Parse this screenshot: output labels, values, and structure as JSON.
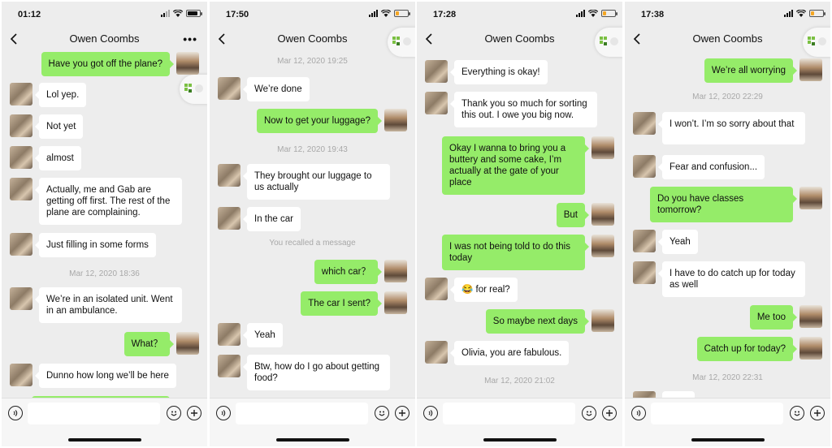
{
  "colors": {
    "outgoing": "#95ec69",
    "incoming": "#ffffff",
    "background": "#ededed",
    "timestamp": "#a8a8a8"
  },
  "icons": {
    "back": "chevron-left-icon",
    "more": "more-dots-icon",
    "voice": "voice-icon",
    "emoji": "emoji-icon",
    "plus": "plus-icon",
    "floating": "mini-program-icon"
  },
  "panels": [
    {
      "time": "01:12",
      "title": "Owen Coombs",
      "more": "•••",
      "battery": "full",
      "messages": [
        {
          "text": "Have you got off the plane?"
        },
        {
          "text": "Lol yep."
        },
        {
          "text": "Not yet"
        },
        {
          "text": "almost"
        },
        {
          "text": "Actually, me and Gab are getting off first. The rest of the plane are complaining."
        },
        {
          "text": "Just filling in some forms"
        },
        {
          "text": "Mar 12, 2020 18:36"
        },
        {
          "text": "We’re in an isolated unit. Went in an ambulance."
        },
        {
          "text": "What？"
        },
        {
          "text": "Dunno how long we’ll be here"
        }
      ]
    },
    {
      "time": "17:50",
      "title": "Owen Coombs",
      "battery": "low",
      "messages": [
        {
          "text": "Mar 12, 2020 19:25"
        },
        {
          "text": "We’re done"
        },
        {
          "text": "Now to get your luggage?"
        },
        {
          "text": "Mar 12, 2020 19:43"
        },
        {
          "text": " They brought our luggage to us actually"
        },
        {
          "text": "In the car"
        },
        {
          "text": "You recalled a message"
        },
        {
          "text": "which car？"
        },
        {
          "text": "The car I sent?"
        },
        {
          "text": "Yeah"
        },
        {
          "text": "Btw, how do I go about getting food?"
        }
      ]
    },
    {
      "time": "17:28",
      "title": "Owen Coombs",
      "battery": "low",
      "messages": [
        {
          "text": "Everything is okay!"
        },
        {
          "text": "Thank you so much for sorting this out. I owe you big now."
        },
        {
          "text": "Okay I wanna to bring you a buttery and some cake, I’m actually at the gate of your place"
        },
        {
          "text": "But"
        },
        {
          "text": "I was not being told to do this today"
        },
        {
          "text": "😂 for real?"
        },
        {
          "text": "So maybe next days"
        },
        {
          "text": "Olivia, you are fabulous."
        },
        {
          "text": "Mar 12, 2020 21:02"
        }
      ]
    },
    {
      "time": "17:38",
      "title": "Owen Coombs",
      "battery": "low",
      "messages": [
        {
          "text": "We’re all worrying"
        },
        {
          "text": "Mar 12, 2020 22:29"
        },
        {
          "text": " I won’t. I’m so sorry about that"
        },
        {
          "text": "Fear and confusion..."
        },
        {
          "text": "Do you have classes tomorrow?"
        },
        {
          "text": "Yeah"
        },
        {
          "text": "I have to do catch up for today as well"
        },
        {
          "text": "Me too"
        },
        {
          "text": "Catch up for today?"
        },
        {
          "text": "Mar 12, 2020 22:31"
        }
      ]
    }
  ]
}
